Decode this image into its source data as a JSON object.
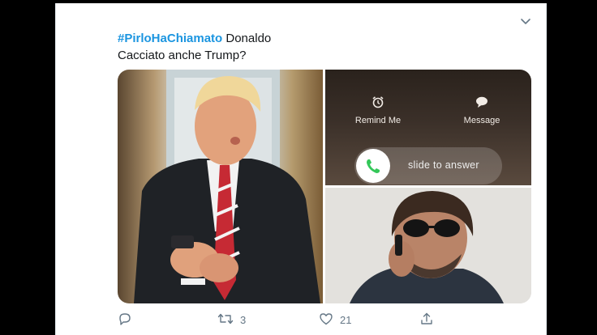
{
  "tweet": {
    "hashtag": "#PirloHaChiamato",
    "text_line1_rest": " Donaldo",
    "text_line2": "Cacciato anche Trump?"
  },
  "media": {
    "call_screen": {
      "remind_label": "Remind Me",
      "message_label": "Message",
      "slide_text": "slide to answer"
    }
  },
  "actions": {
    "retweet_count": "3",
    "like_count": "21"
  },
  "colors": {
    "hashtag": "#1b95e0",
    "action_gray": "#657786",
    "call_green": "#34c759"
  },
  "icons": [
    "chevron-down-icon",
    "alarm-icon",
    "message-bubble-icon",
    "phone-icon",
    "reply-icon",
    "retweet-icon",
    "like-icon",
    "share-icon"
  ]
}
